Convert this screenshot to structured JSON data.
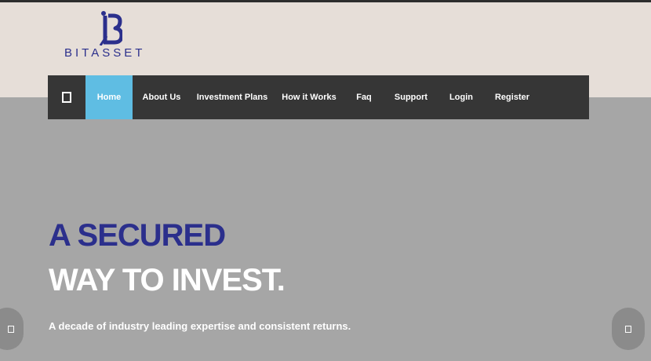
{
  "brand": {
    "name": "BITASSET",
    "color": "#2b2f8c"
  },
  "nav": {
    "toggle_icon": "square-icon",
    "items": [
      {
        "label": "Home",
        "active": true
      },
      {
        "label": "About Us"
      },
      {
        "label": "Investment Plans"
      },
      {
        "label": "How it Works"
      },
      {
        "label": "Faq"
      },
      {
        "label": "Support"
      },
      {
        "label": "Login"
      },
      {
        "label": "Register"
      }
    ],
    "active_color": "#5fbde3",
    "bar_color": "#363636"
  },
  "hero": {
    "title_line1": "A SECURED",
    "title_line2": "WAY TO INVEST.",
    "subtitle": "A decade of industry leading expertise and consistent returns.",
    "background_color": "#a6a6a6"
  },
  "slider": {
    "prev_icon": "square-icon",
    "next_icon": "square-icon"
  }
}
